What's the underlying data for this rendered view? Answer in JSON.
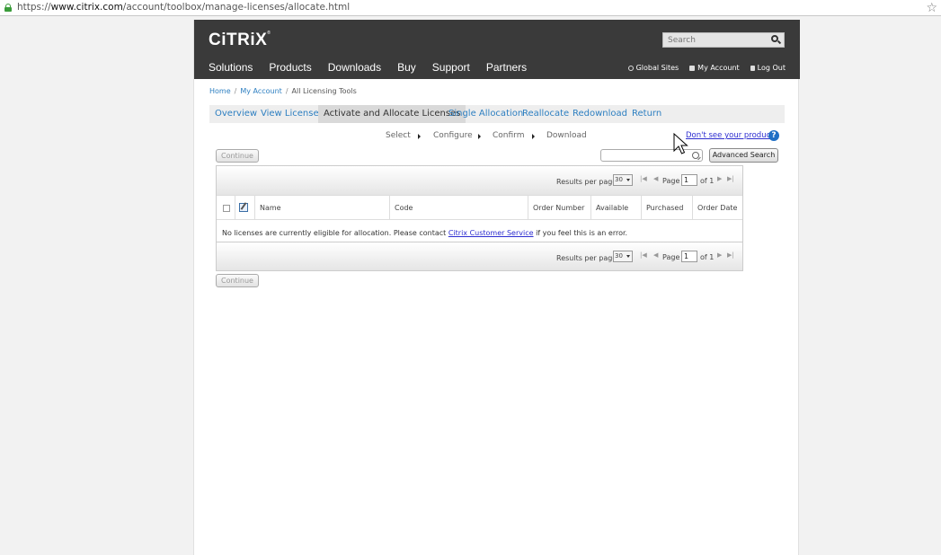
{
  "browser": {
    "url_scheme": "https://",
    "url_host": "www.citrix.com",
    "url_path": "/account/toolbox/manage-licenses/allocate.html",
    "bookmark_icon": "star-icon"
  },
  "header": {
    "logo": "CiTRiX",
    "logo_tm": "®",
    "search_placeholder": "Search",
    "nav": [
      "Solutions",
      "Products",
      "Downloads",
      "Buy",
      "Support",
      "Partners"
    ],
    "utility": {
      "global_sites": "Global Sites",
      "my_account": "My Account",
      "log_out": "Log Out"
    },
    "bg_color": "#3a3a3a"
  },
  "breadcrumb": {
    "home": "Home",
    "my_account": "My Account",
    "current": "All Licensing Tools",
    "separator": "/"
  },
  "subnav": {
    "items": [
      "Overview",
      "View Licenses",
      "Activate and Allocate Licenses",
      "Single Allocation",
      "Reallocate",
      "Redownload",
      "Return"
    ],
    "active_index": 2,
    "link_color": "#2d7fc1"
  },
  "steps": [
    "Select",
    "Configure",
    "Confirm",
    "Download"
  ],
  "help": {
    "dont_see": "Don't see your product?",
    "icon": "?"
  },
  "toolbar": {
    "continue_label": "Continue",
    "advanced_search_label": "Advanced Search"
  },
  "grid": {
    "results_per_page_label": "Results per page",
    "results_per_page_value": "30",
    "page_label": "Page",
    "page_value": "1",
    "of_label": "of 1",
    "columns": [
      "Name",
      "Code",
      "Order Number",
      "Available",
      "Purchased",
      "Order Date"
    ],
    "empty_pre": "No licenses are currently eligible for allocation. Please contact",
    "empty_link": "Citrix Customer Service",
    "empty_post": "if you feel this is an error."
  }
}
